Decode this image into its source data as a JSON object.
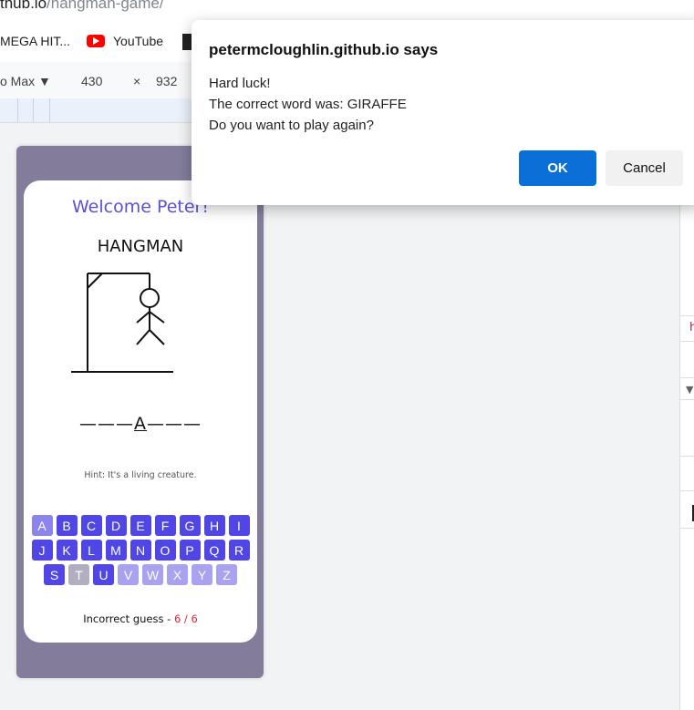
{
  "browser": {
    "url_host": "thub.io",
    "url_path": "/hangman-game/",
    "bookmarks": [
      {
        "label": "MEGA HIT..."
      },
      {
        "label": "YouTube"
      }
    ],
    "device": {
      "name": "o Max",
      "width": "430",
      "times": "×",
      "height": "932"
    }
  },
  "devtools": {
    "snippet": "h"
  },
  "app": {
    "welcome": "Welcome Peter!",
    "title": "HANGMAN",
    "word_parts": [
      "———",
      "A",
      "———"
    ],
    "hint": "Hint: It's a living creature.",
    "keyboard": [
      [
        {
          "l": "A",
          "s": "faded"
        },
        {
          "l": "B",
          "s": "on"
        },
        {
          "l": "C",
          "s": "on"
        },
        {
          "l": "D",
          "s": "on"
        },
        {
          "l": "E",
          "s": "on"
        },
        {
          "l": "F",
          "s": "on"
        },
        {
          "l": "G",
          "s": "on"
        },
        {
          "l": "H",
          "s": "on"
        },
        {
          "l": "I",
          "s": "on"
        }
      ],
      [
        {
          "l": "J",
          "s": "on"
        },
        {
          "l": "K",
          "s": "on"
        },
        {
          "l": "L",
          "s": "on"
        },
        {
          "l": "M",
          "s": "on"
        },
        {
          "l": "N",
          "s": "on"
        },
        {
          "l": "O",
          "s": "on"
        },
        {
          "l": "P",
          "s": "on"
        },
        {
          "l": "Q",
          "s": "on"
        },
        {
          "l": "R",
          "s": "on"
        }
      ],
      [
        {
          "l": "S",
          "s": "on"
        },
        {
          "l": "T",
          "s": "right"
        },
        {
          "l": "U",
          "s": "on"
        },
        {
          "l": "V",
          "s": "wrong"
        },
        {
          "l": "W",
          "s": "wrong"
        },
        {
          "l": "X",
          "s": "wrong"
        },
        {
          "l": "Y",
          "s": "wrong"
        },
        {
          "l": "Z",
          "s": "wrong"
        }
      ]
    ],
    "incorrect_label": "Incorrect guess - ",
    "incorrect_count": "6 / 6"
  },
  "dialog": {
    "title": "petermcloughlin.github.io says",
    "lines": [
      "Hard luck!",
      "The correct word was: GIRAFFE",
      "Do you want to play again?"
    ],
    "ok_label": "OK",
    "cancel_label": "Cancel"
  },
  "colors": {
    "accent": "#4f46e5",
    "phone_frame": "#837d9b",
    "ok_button": "#0a6fd6",
    "incorrect_count": "#e0263a"
  }
}
